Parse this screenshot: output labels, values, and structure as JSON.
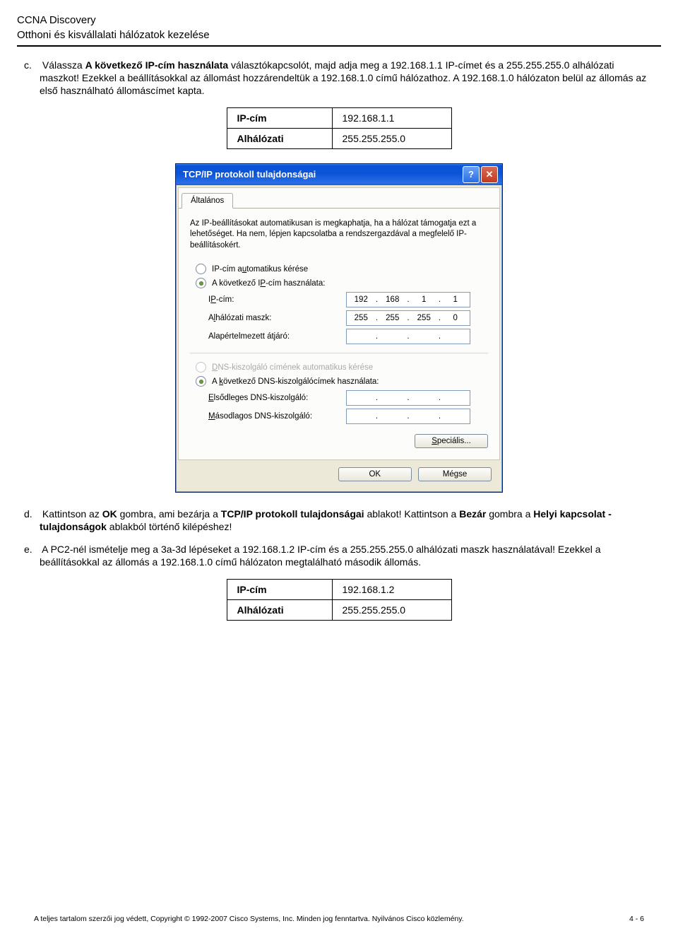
{
  "header": {
    "title": "CCNA Discovery",
    "subtitle": "Otthoni és kisvállalati hálózatok kezelése"
  },
  "item_c": {
    "marker": "c.",
    "text_1": "Válassza ",
    "bold_1": "A következő IP-cím használata",
    "text_2": " választókapcsolót, majd adja meg a 192.168.1.1 IP-címet és a 255.255.255.0 alhálózati maszkot! Ezekkel a beállításokkal az állomást hozzárendeltük a 192.168.1.0 című hálózathoz. A 192.168.1.0 hálózaton belül az állomás az első használható állomáscímet kapta."
  },
  "table_c": {
    "r1c1": "IP-cím",
    "r1c2": "192.168.1.1",
    "r2c1": "Alhálózati",
    "r2c2": "255.255.255.0"
  },
  "dialog": {
    "title": "TCP/IP protokoll tulajdonságai",
    "tab": "Általános",
    "intro": "Az IP-beállításokat automatikusan is megkaphatja, ha a hálózat támogatja ezt a lehetőséget. Ha nem, lépjen kapcsolatba a rendszergazdával a megfelelő IP-beállításokért.",
    "r_auto_ip_pre": "IP-cím a",
    "r_auto_ip_u": "u",
    "r_auto_ip_post": "tomatikus kérése",
    "r_use_ip": "A következő I",
    "r_use_ip_u": "P",
    "r_use_ip_post": "-cím használata:",
    "lbl_ip_pre": "I",
    "lbl_ip_u": "P",
    "lbl_ip_post": "-cím:",
    "lbl_mask_pre": "A",
    "lbl_mask_u": "l",
    "lbl_mask_post": "hálózati maszk:",
    "lbl_gw": "Alapértelmezett átjáró:",
    "ip": {
      "o1": "192",
      "o2": "168",
      "o3": "1",
      "o4": "1"
    },
    "mask": {
      "o1": "255",
      "o2": "255",
      "o3": "255",
      "o4": "0"
    },
    "r_auto_dns_pre": "",
    "r_auto_dns_u": "D",
    "r_auto_dns_post": "NS-kiszolgáló címének automatikus kérése",
    "r_use_dns_pre": "A ",
    "r_use_dns_u": "k",
    "r_use_dns_post": "övetkező DNS-kiszolgálócímek használata:",
    "lbl_dns1_pre": "",
    "lbl_dns1_u": "E",
    "lbl_dns1_post": "lsődleges DNS-kiszolgáló:",
    "lbl_dns2_pre": "",
    "lbl_dns2_u": "M",
    "lbl_dns2_post": "ásodlagos DNS-kiszolgáló:",
    "btn_special_u": "S",
    "btn_special_post": "peciális...",
    "btn_ok": "OK",
    "btn_cancel": "Mégse"
  },
  "item_d": {
    "marker": "d.",
    "text_1": "Kattintson az ",
    "bold_1": "OK",
    "text_2": " gombra, ami bezárja a ",
    "bold_2": "TCP/IP protokoll tulajdonságai",
    "text_3": " ablakot! Kattintson a ",
    "bold_3": "Bezár",
    "text_4": " gombra a ",
    "bold_4": "Helyi kapcsolat - tulajdonságok",
    "text_5": " ablakból történő kilépéshez!"
  },
  "item_e": {
    "marker": "e.",
    "text": "A PC2-nél ismételje meg a 3a-3d lépéseket a 192.168.1.2 IP-cím és a 255.255.255.0 alhálózati maszk használatával! Ezekkel a beállításokkal az állomás a 192.168.1.0 című hálózaton megtalálható második állomás."
  },
  "table_e": {
    "r1c1": "IP-cím",
    "r1c2": "192.168.1.2",
    "r2c1": "Alhálózati",
    "r2c2": "255.255.255.0"
  },
  "footer": {
    "left": "A teljes tartalom szerzői jog védett, Copyright © 1992-2007 Cisco Systems, Inc. Minden jog fenntartva. Nyilvános Cisco közlemény.",
    "right": "4 - 6"
  }
}
